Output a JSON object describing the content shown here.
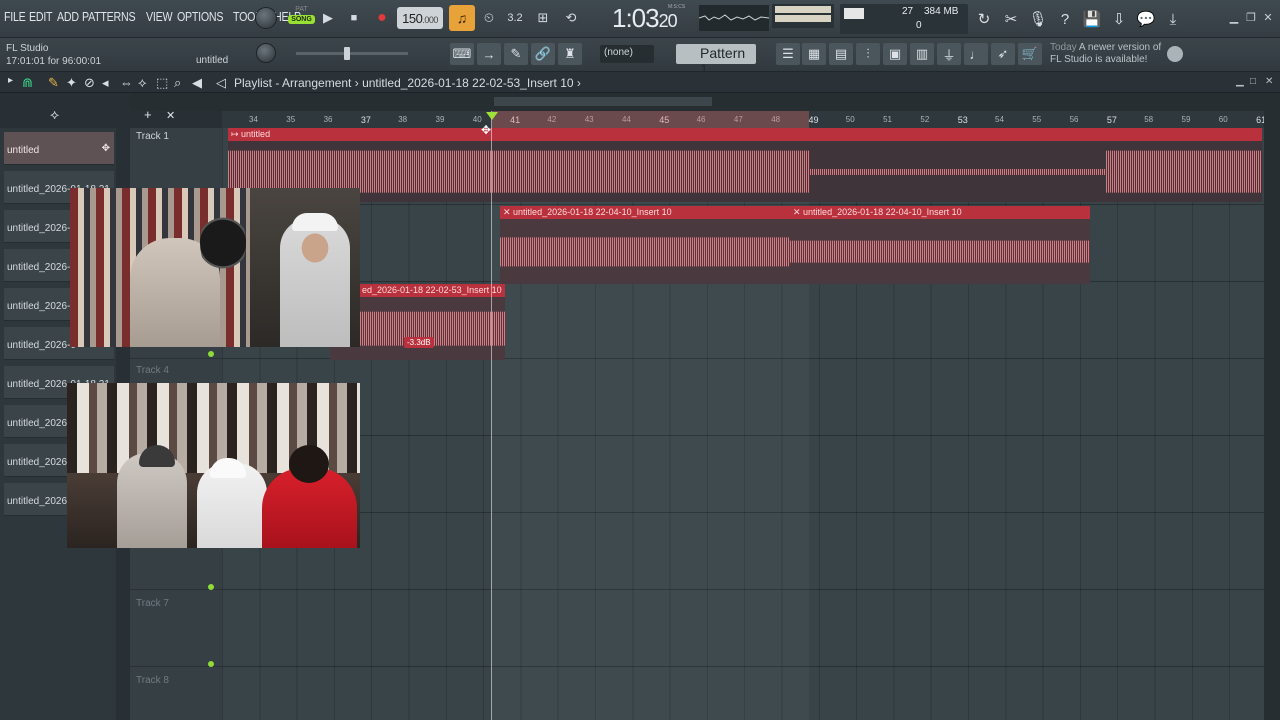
{
  "menu": [
    "FILE",
    "EDIT",
    "ADD",
    "PATTERNS",
    "VIEW",
    "OPTIONS",
    "TOOLS",
    "HELP"
  ],
  "transport": {
    "mode_pat": "PAT",
    "mode_song": "SONG",
    "play": "▶",
    "stop": "■",
    "record": "●",
    "tempo_main": "150",
    "tempo_frac": ".000",
    "time_main": "1:03",
    "time_sub": "20",
    "time_label": "M:S:CS"
  },
  "monitor": {
    "cpu": "27",
    "ram": "384 MB",
    "voices": "0"
  },
  "status": {
    "app": "FL Studio",
    "time_info": "17:01:01 for 96:00:01",
    "project": "untitled"
  },
  "toolbar2": {
    "channel_select": "(none)",
    "pattern": "Pattern 1"
  },
  "news": {
    "when": "Today",
    "text1": "A newer version of",
    "text2": "FL Studio is available!"
  },
  "playlist": {
    "title": "Playlist - Arrangement",
    "breadcrumb": "untitled_2026-01-18 22-02-53_Insert 10",
    "arrow": "›"
  },
  "picker": [
    "untitled",
    "untitled_2026-01-18 21",
    "untitled_2026-0",
    "untitled_2026-0",
    "untitled_2026-0",
    "untitled_2026-0",
    "untitled_2026-01-18 21",
    "untitled_2026-0",
    "untitled_2026-0",
    "untitled_2026-0"
  ],
  "tracks": [
    "Track 1",
    "",
    "",
    "Track 4",
    "",
    "",
    "Track 7",
    "Track 8"
  ],
  "ruler": [
    "34",
    "35",
    "36",
    "37",
    "38",
    "39",
    "40",
    "41",
    "42",
    "43",
    "44",
    "45",
    "46",
    "47",
    "48",
    "49",
    "50",
    "51",
    "52",
    "53",
    "54",
    "55",
    "56",
    "57",
    "58",
    "59",
    "60",
    "61"
  ],
  "clips": {
    "c1": "untitled",
    "c2": "untitled_2026-01-18 22-04-10_Insert 10",
    "c3": "untitled_2026-01-18 22-04-10_Insert 10",
    "c4": "ed_2026-01-18 22-02-53_Insert 10",
    "gain": "-3.3dB"
  },
  "colors": {
    "clip_header": "#b8313c",
    "wave": "#ee7f88",
    "song_toggle": "#9adf33",
    "metronome": "#e8a23a"
  }
}
